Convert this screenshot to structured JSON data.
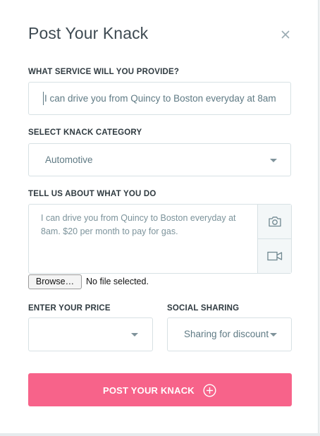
{
  "modal": {
    "title": "Post Your Knack",
    "close_icon": "close-icon"
  },
  "service": {
    "label": "WHAT SERVICE WILL YOU PROVIDE?",
    "value": "I can drive you from Quincy to Boston everyday at 8am"
  },
  "category": {
    "label": "SELECT KNACK CATEGORY",
    "selected": "Automotive",
    "icon": "chevron-down-icon"
  },
  "about": {
    "label": "TELL US ABOUT WHAT YOU DO",
    "value": "I can drive you from Quincy to Boston everyday at 8am. $20 per month to pay for gas.",
    "camera_icon": "camera-icon",
    "video_icon": "video-camera-icon"
  },
  "file_upload": {
    "button_label": "Browse…",
    "status": "No file selected."
  },
  "price": {
    "label": "ENTER YOUR PRICE",
    "selected": ""
  },
  "social": {
    "label": "SOCIAL SHARING",
    "selected": "Sharing for discount"
  },
  "submit": {
    "label": "POST YOUR KNACK",
    "icon": "plus-circle-icon"
  },
  "colors": {
    "accent": "#f7638a",
    "text_dark": "#3e4a52",
    "input_text": "#5f7a84",
    "border": "#d7e1e4"
  }
}
